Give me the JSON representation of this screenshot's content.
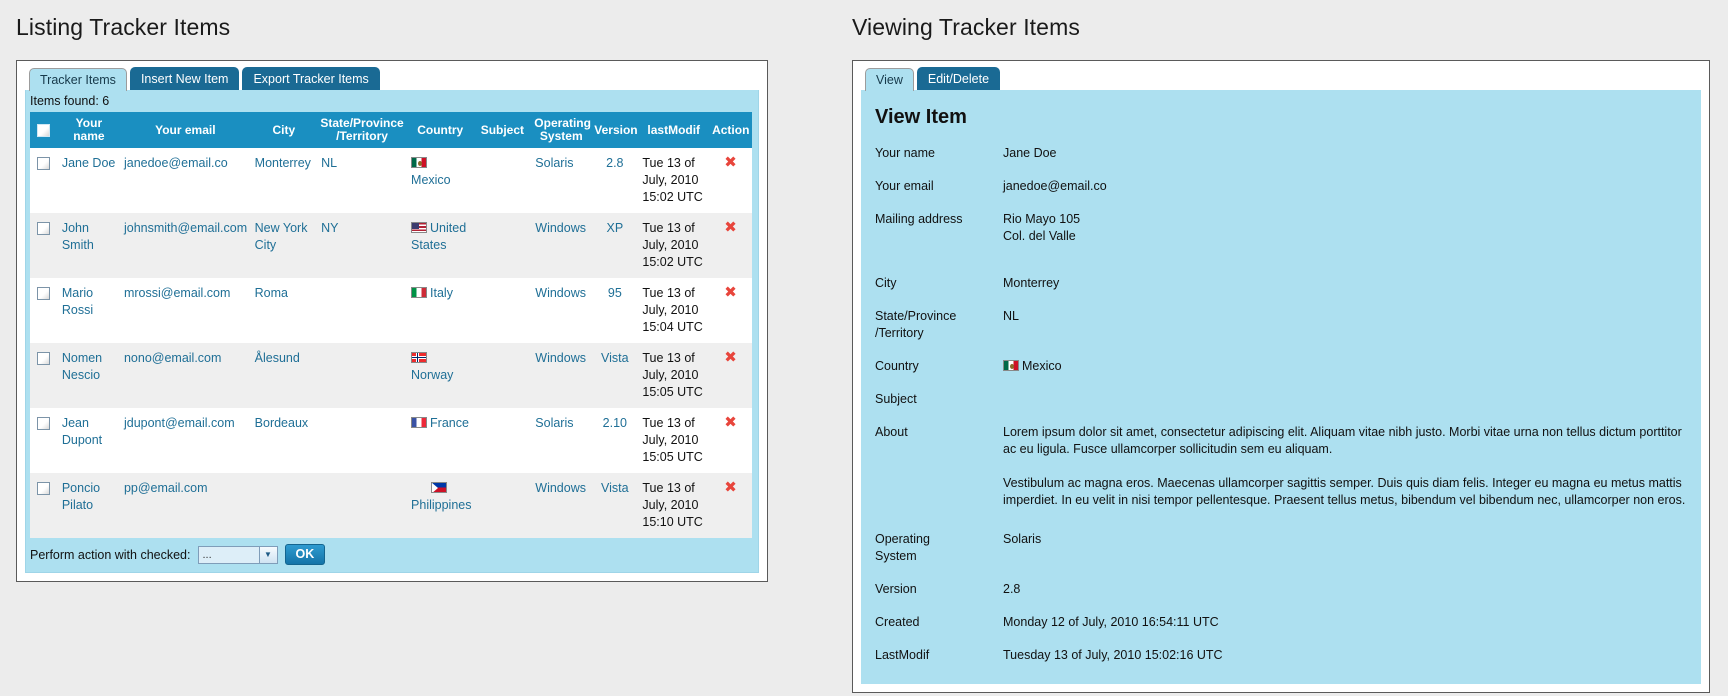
{
  "left": {
    "heading": "Listing Tracker Items",
    "tabs": [
      {
        "label": "Tracker Items",
        "active": true
      },
      {
        "label": "Insert New Item",
        "active": false
      },
      {
        "label": "Export Tracker Items",
        "active": false
      }
    ],
    "items_found": "Items found: 6",
    "columns": [
      "",
      "Your name",
      "Your email",
      "City",
      "State/Province /Territory",
      "Country",
      "Subject",
      "Operating System",
      "Version",
      "lastModif",
      "Action"
    ],
    "column_header_1": "Your name",
    "column_header_2": "Your email",
    "column_header_3": "City",
    "column_header_4": "State/Province /Territory",
    "column_header_5": "Country",
    "column_header_6": "Subject",
    "column_header_7": "Operating System",
    "column_header_8": "Version",
    "column_header_9": "lastModif",
    "column_header_10": "Action",
    "rows": [
      {
        "name": "Jane Doe",
        "email": "janedoe@email.co",
        "city": "Monterrey",
        "state": "NL",
        "country": "Mexico",
        "flag": "mx",
        "subject": "",
        "os": "Solaris",
        "version": "2.8",
        "lastmodif": "Tue 13 of July, 2010 15:02 UTC"
      },
      {
        "name": "John Smith",
        "email": "johnsmith@email.com",
        "city": "New York City",
        "state": "NY",
        "country": "United States",
        "flag": "us",
        "subject": "",
        "os": "Windows",
        "version": "XP",
        "lastmodif": "Tue 13 of July, 2010 15:02 UTC"
      },
      {
        "name": "Mario Rossi",
        "email": "mrossi@email.com",
        "city": "Roma",
        "state": "",
        "country": "Italy",
        "flag": "it",
        "subject": "",
        "os": "Windows",
        "version": "95",
        "lastmodif": "Tue 13 of July, 2010 15:04 UTC"
      },
      {
        "name": "Nomen Nescio",
        "email": "nono@email.com",
        "city": "Ålesund",
        "state": "",
        "country": "Norway",
        "flag": "no",
        "subject": "",
        "os": "Windows",
        "version": "Vista",
        "lastmodif": "Tue 13 of July, 2010 15:05 UTC"
      },
      {
        "name": "Jean Dupont",
        "email": "jdupont@email.com",
        "city": "Bordeaux",
        "state": "",
        "country": "France",
        "flag": "fr",
        "subject": "",
        "os": "Solaris",
        "version": "2.10",
        "lastmodif": "Tue 13 of July, 2010 15:05 UTC"
      },
      {
        "name": "Poncio Pilato",
        "email": "pp@email.com",
        "city": "",
        "state": "",
        "country": "Philippines",
        "flag": "ph",
        "subject": "",
        "os": "Windows",
        "version": "Vista",
        "lastmodif": "Tue 13 of July, 2010 15:10 UTC"
      }
    ],
    "footer": {
      "label": "Perform action with checked:",
      "select_value": "...",
      "ok_label": "OK"
    }
  },
  "right": {
    "heading": "Viewing Tracker Items",
    "tabs": [
      {
        "label": "View",
        "active": true
      },
      {
        "label": "Edit/Delete",
        "active": false
      }
    ],
    "title": "View Item",
    "fields": [
      {
        "label": "Your name",
        "value": "Jane Doe"
      },
      {
        "label": "Your email",
        "value": "janedoe@email.co"
      },
      {
        "label": "Mailing address",
        "value": "Rio Mayo 105\nCol. del Valle"
      },
      {
        "label": "City",
        "value": "Monterrey"
      },
      {
        "label": "State/Province /Territory",
        "value": "NL"
      },
      {
        "label": "Country",
        "value": "Mexico",
        "flag": "mx"
      },
      {
        "label": "Subject",
        "value": ""
      },
      {
        "label": "About",
        "value": ""
      },
      {
        "label": "Operating System",
        "value": "Solaris"
      },
      {
        "label": "Version",
        "value": "2.8"
      },
      {
        "label": "Created",
        "value": "Monday 12 of July, 2010 16:54:11 UTC"
      },
      {
        "label": "LastModif",
        "value": "Tuesday 13 of July, 2010 15:02:16 UTC"
      }
    ],
    "field_name_label": "Your name",
    "field_name_value": "Jane Doe",
    "field_email_label": "Your email",
    "field_email_value": "janedoe@email.co",
    "field_address_label": "Mailing address",
    "field_address_line1": "Rio Mayo 105",
    "field_address_line2": "Col. del Valle",
    "field_city_label": "City",
    "field_city_value": "Monterrey",
    "field_state_label": "State/Province /Territory",
    "field_state_value": "NL",
    "field_country_label": "Country",
    "field_country_value": "Mexico",
    "field_subject_label": "Subject",
    "field_subject_value": "",
    "field_about_label": "About",
    "field_about_p1": "Lorem ipsum dolor sit amet, consectetur adipiscing elit. Aliquam vitae nibh justo. Morbi vitae urna non tellus dictum porttitor ac eu ligula. Fusce ullamcorper sollicitudin sem eu aliquam.",
    "field_about_p2": "Vestibulum ac magna eros. Maecenas ullamcorper sagittis semper. Duis quis diam felis. Integer eu magna eu metus mattis imperdiet. In eu velit in nisi tempor pellentesque. Praesent tellus metus, bibendum vel bibendum nec, ullamcorper non eros.",
    "field_os_label": "Operating System",
    "field_os_value": "Solaris",
    "field_version_label": "Version",
    "field_version_value": "2.8",
    "field_created_label": "Created",
    "field_created_value": "Monday 12 of July, 2010 16:54:11 UTC",
    "field_lastmodif_label": "LastModif",
    "field_lastmodif_value": "Tuesday 13 of July, 2010 15:02:16 UTC"
  },
  "colors": {
    "header_blue": "#1a8fc1",
    "panel_blue": "#ade0f0",
    "tab_inactive": "#1a6a94",
    "link_blue": "#1f6f96",
    "delete_red": "#e8453c",
    "page_bg": "#ececec"
  }
}
